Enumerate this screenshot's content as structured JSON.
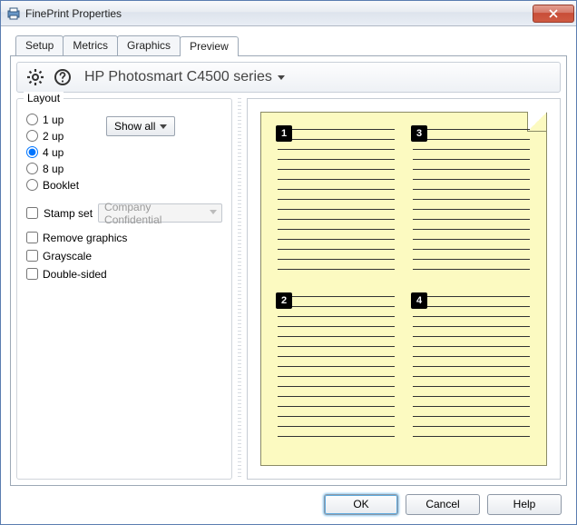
{
  "window": {
    "title": "FinePrint Properties"
  },
  "tabs": [
    {
      "label": "Setup"
    },
    {
      "label": "Metrics"
    },
    {
      "label": "Graphics"
    },
    {
      "label": "Preview"
    }
  ],
  "active_tab_index": 3,
  "toolbar": {
    "printer_label": "HP Photosmart C4500 series"
  },
  "layout": {
    "group_title": "Layout",
    "options": [
      {
        "label": "1 up",
        "selected": false
      },
      {
        "label": "2 up",
        "selected": false
      },
      {
        "label": "4 up",
        "selected": true
      },
      {
        "label": "8 up",
        "selected": false
      },
      {
        "label": "Booklet",
        "selected": false
      }
    ],
    "show_all_label": "Show all",
    "stamp": {
      "label": "Stamp set",
      "checked": false,
      "value": "Company Confidential"
    },
    "checkboxes": {
      "remove_graphics": {
        "label": "Remove graphics",
        "checked": false
      },
      "grayscale": {
        "label": "Grayscale",
        "checked": false
      },
      "double_sided": {
        "label": "Double-sided",
        "checked": false
      }
    }
  },
  "preview": {
    "page_numbers": [
      "1",
      "3",
      "2",
      "4"
    ]
  },
  "footer": {
    "ok": "OK",
    "cancel": "Cancel",
    "help": "Help"
  }
}
